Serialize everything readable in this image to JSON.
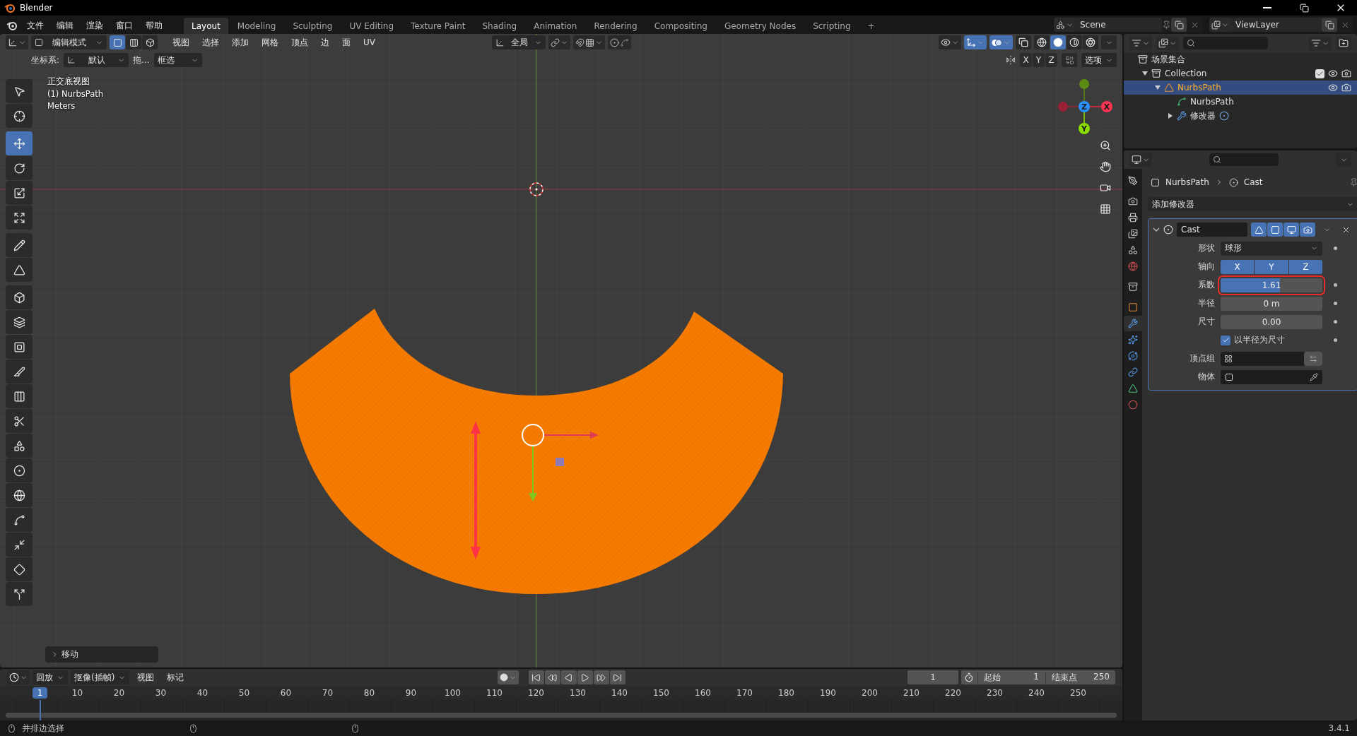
{
  "window": {
    "title": "Blender"
  },
  "menu": [
    "文件",
    "编辑",
    "渲染",
    "窗口",
    "帮助"
  ],
  "workspaces": [
    {
      "label": "Layout",
      "selected": true
    },
    {
      "label": "Modeling",
      "selected": false
    },
    {
      "label": "Sculpting",
      "selected": false
    },
    {
      "label": "UV Editing",
      "selected": false
    },
    {
      "label": "Texture Paint",
      "selected": false
    },
    {
      "label": "Shading",
      "selected": false
    },
    {
      "label": "Animation",
      "selected": false
    },
    {
      "label": "Rendering",
      "selected": false
    },
    {
      "label": "Compositing",
      "selected": false
    },
    {
      "label": "Geometry Nodes",
      "selected": false
    },
    {
      "label": "Scripting",
      "selected": false
    }
  ],
  "add_workspace": "+",
  "scene": "Scene",
  "view_layer": "ViewLayer",
  "viewport_header": {
    "mode": "编辑模式",
    "select_modes": [
      {
        "selected": true
      },
      {
        "selected": false
      },
      {
        "selected": false
      }
    ],
    "menus": [
      "视图",
      "选择",
      "添加",
      "网格",
      "顶点",
      "边",
      "面",
      "UV"
    ],
    "orientation": "全局",
    "toggles": [
      {
        "selected": true
      },
      {
        "selected": true
      },
      {
        "selected": false
      }
    ],
    "shading": [
      {
        "selected": false
      },
      {
        "selected": true
      },
      {
        "selected": false
      },
      {
        "selected": false
      }
    ]
  },
  "tool_settings": {
    "coord_label": "坐标系:",
    "coord_value": "默认",
    "drag_label": "拖...",
    "select_value": "框选",
    "mirror_axes": [
      {
        "label": "X",
        "selected": false
      },
      {
        "label": "Y",
        "selected": false
      },
      {
        "label": "Z",
        "selected": false
      }
    ],
    "options": "选项"
  },
  "overlay_info": [
    "正交底视图",
    "(1) NurbsPath",
    "Meters"
  ],
  "gizmo_axes": [
    {
      "label": "X",
      "color": "#ff3352"
    },
    {
      "label": "Y",
      "color": "#8bdc00"
    },
    {
      "label": "Z",
      "color": "#2890ff"
    }
  ],
  "tools": [
    {
      "selected": false
    },
    {
      "selected": false
    },
    {
      "selected": true
    },
    {
      "selected": false
    },
    {
      "selected": false
    },
    {
      "selected": false
    },
    {
      "selected": false
    },
    {
      "selected": false
    },
    {
      "selected": false
    },
    {
      "selected": false
    },
    {
      "selected": false
    },
    {
      "selected": false
    },
    {
      "selected": false
    },
    {
      "selected": false
    },
    {
      "selected": false
    },
    {
      "selected": false
    },
    {
      "selected": false
    },
    {
      "selected": false
    },
    {
      "selected": false
    },
    {
      "selected": false
    },
    {
      "selected": false
    }
  ],
  "last_operator": "移动",
  "outliner": {
    "root": "场景集合",
    "items": [
      {
        "label": "Collection",
        "kind": "collection",
        "expanded": true,
        "selected": false,
        "checked": true,
        "children": [
          {
            "label": "NurbsPath",
            "kind": "object",
            "expanded": true,
            "selected": true,
            "children": [
              {
                "label": "NurbsPath",
                "kind": "data",
                "selected": false
              },
              {
                "label": "修改器",
                "kind": "modifiers",
                "expanded": false,
                "selected": false
              }
            ]
          }
        ]
      }
    ]
  },
  "properties": {
    "tabs": [
      {
        "selected": false
      },
      {
        "selected": false
      },
      {
        "selected": false
      },
      {
        "selected": false
      },
      {
        "selected": false
      },
      {
        "selected": false
      },
      {
        "selected": false
      },
      {
        "selected": false
      },
      {
        "selected": true
      },
      {
        "selected": false
      },
      {
        "selected": false
      },
      {
        "selected": false
      },
      {
        "selected": false
      },
      {
        "selected": false
      }
    ],
    "breadcrumb": [
      "NurbsPath",
      "Cast"
    ],
    "add_modifier": "添加修改器",
    "modifier": {
      "name": "Cast",
      "expanded": true,
      "toggles": [
        {
          "selected": true
        },
        {
          "selected": true
        },
        {
          "selected": true
        },
        {
          "selected": true
        }
      ],
      "fields": [
        {
          "kind": "dropdown",
          "label": "形状",
          "value": "球形"
        },
        {
          "kind": "toggles",
          "label": "轴向",
          "options": [
            {
              "label": "X",
              "selected": true
            },
            {
              "label": "Y",
              "selected": true
            },
            {
              "label": "Z",
              "selected": true
            }
          ]
        },
        {
          "kind": "slider",
          "label": "系数",
          "value": "1.61",
          "level": 0.58,
          "highlighted": true
        },
        {
          "kind": "number",
          "label": "半径",
          "value": "0 m"
        },
        {
          "kind": "number",
          "label": "尺寸",
          "value": "0.00"
        },
        {
          "kind": "checkbox",
          "label": "以半径为尺寸",
          "checked": true
        },
        {
          "kind": "vertex_group",
          "label": "顶点组"
        },
        {
          "kind": "object",
          "label": "物体"
        }
      ]
    }
  },
  "timeline": {
    "menus": [
      {
        "label": "回放",
        "kind": "dropdown"
      },
      {
        "label": "抠像(插帧)",
        "kind": "dropdown"
      },
      {
        "label": "视图",
        "kind": "menu"
      },
      {
        "label": "标记",
        "kind": "menu"
      }
    ],
    "current_frame": "1",
    "start_label": "起始",
    "start": "1",
    "end_label": "结束点",
    "end": "250",
    "ticks": [
      {
        "label": "1",
        "selected": true
      },
      {
        "label": "10",
        "selected": false
      },
      {
        "label": "20",
        "selected": false
      },
      {
        "label": "30",
        "selected": false
      },
      {
        "label": "40",
        "selected": false
      },
      {
        "label": "50",
        "selected": false
      },
      {
        "label": "60",
        "selected": false
      },
      {
        "label": "70",
        "selected": false
      },
      {
        "label": "80",
        "selected": false
      },
      {
        "label": "90",
        "selected": false
      },
      {
        "label": "100",
        "selected": false
      },
      {
        "label": "110",
        "selected": false
      },
      {
        "label": "120",
        "selected": false
      },
      {
        "label": "130",
        "selected": false
      },
      {
        "label": "140",
        "selected": false
      },
      {
        "label": "150",
        "selected": false
      },
      {
        "label": "160",
        "selected": false
      },
      {
        "label": "170",
        "selected": false
      },
      {
        "label": "180",
        "selected": false
      },
      {
        "label": "190",
        "selected": false
      },
      {
        "label": "200",
        "selected": false
      },
      {
        "label": "210",
        "selected": false
      },
      {
        "label": "220",
        "selected": false
      },
      {
        "label": "230",
        "selected": false
      },
      {
        "label": "240",
        "selected": false
      },
      {
        "label": "250",
        "selected": false
      }
    ]
  },
  "status_bar": {
    "hint": "并排边选择",
    "version": "3.4.1"
  }
}
